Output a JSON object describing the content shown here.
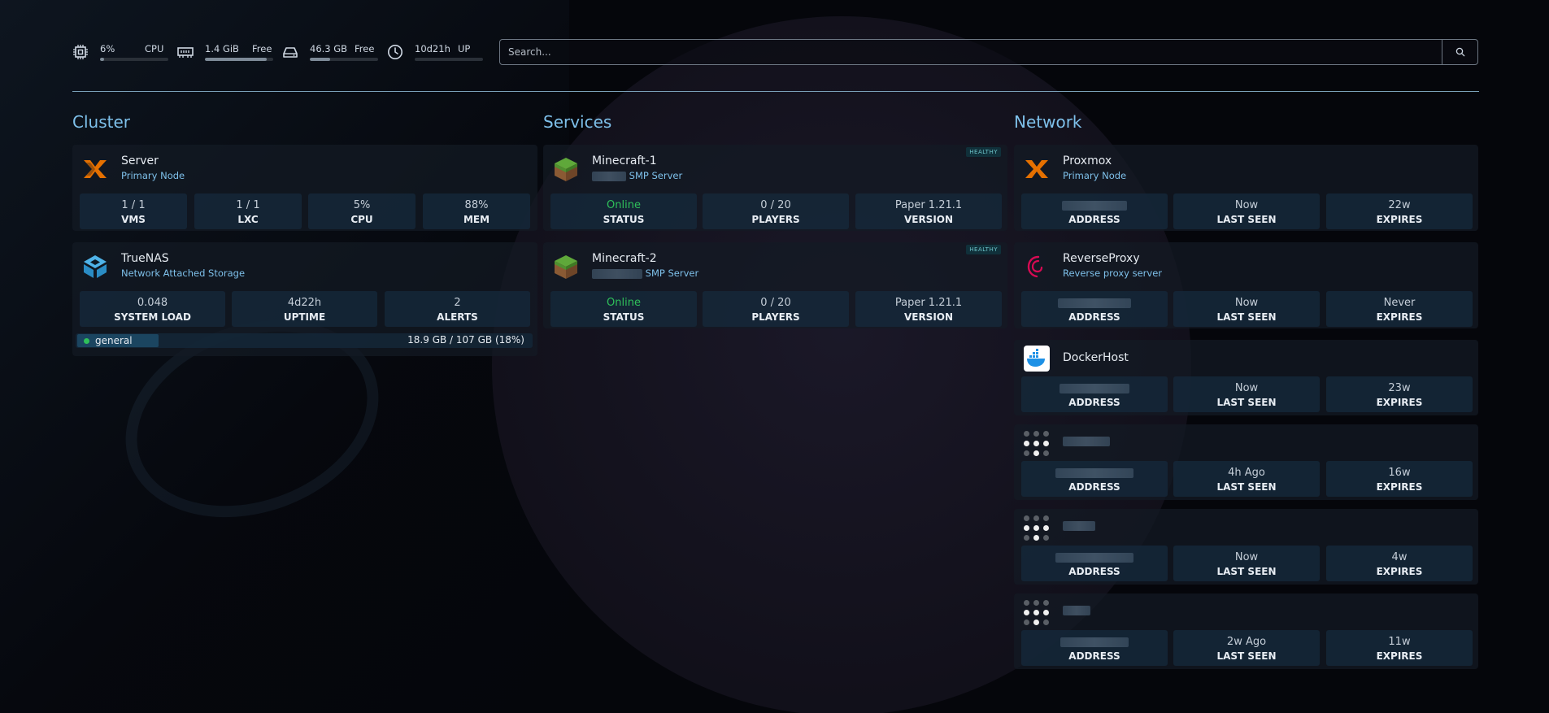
{
  "topbar": {
    "cpu": {
      "value": "6%",
      "label": "CPU",
      "fraction": 0.06
    },
    "memory": {
      "value": "1.4 GiB",
      "label": "Free",
      "fraction": 0.9
    },
    "disk": {
      "value": "46.3 GB",
      "label": "Free",
      "fraction": 0.3
    },
    "uptime": {
      "value": "10d21h",
      "label": "UP",
      "fraction": 0.0
    },
    "search_placeholder": "Search..."
  },
  "cluster": {
    "title": "Cluster",
    "cards": [
      {
        "name": "Server",
        "subtitle": "Primary Node",
        "logo": "proxmox-logo",
        "stats": [
          {
            "value": "1 / 1",
            "label": "VMS"
          },
          {
            "value": "1 / 1",
            "label": "LXC"
          },
          {
            "value": "5%",
            "label": "CPU"
          },
          {
            "value": "88%",
            "label": "MEM"
          }
        ]
      },
      {
        "name": "TrueNAS",
        "subtitle": "Network Attached Storage",
        "logo": "truenas-logo",
        "stats": [
          {
            "value": "0.048",
            "label": "SYSTEM LOAD"
          },
          {
            "value": "4d22h",
            "label": "UPTIME"
          },
          {
            "value": "2",
            "label": "ALERTS"
          }
        ],
        "pool": {
          "name": "general",
          "usage": "18.9 GB / 107 GB  (18%)"
        }
      }
    ]
  },
  "services": {
    "title": "Services",
    "cards": [
      {
        "name": "Minecraft-1",
        "subtitle": "SMP Server",
        "badge": "HEALTHY",
        "logo": "minecraft-grass-icon",
        "stats": [
          {
            "value": "Online",
            "label": "STATUS"
          },
          {
            "value": "0 / 20",
            "label": "PLAYERS"
          },
          {
            "value": "Paper 1.21.1",
            "label": "VERSION"
          }
        ]
      },
      {
        "name": "Minecraft-2",
        "subtitle": "SMP Server",
        "badge": "HEALTHY",
        "logo": "minecraft-grass-icon",
        "stats": [
          {
            "value": "Online",
            "label": "STATUS"
          },
          {
            "value": "0 / 20",
            "label": "PLAYERS"
          },
          {
            "value": "Paper 1.21.1",
            "label": "VERSION"
          }
        ]
      }
    ]
  },
  "network": {
    "title": "Network",
    "cards": [
      {
        "name": "Proxmox",
        "subtitle": "Primary Node",
        "logo": "proxmox-logo",
        "stats": [
          {
            "value": "",
            "label": "ADDRESS"
          },
          {
            "value": "Now",
            "label": "LAST SEEN"
          },
          {
            "value": "22w",
            "label": "EXPIRES"
          }
        ]
      },
      {
        "name": "ReverseProxy",
        "subtitle": "Reverse proxy server",
        "logo": "debian-logo",
        "stats": [
          {
            "value": "",
            "label": "ADDRESS"
          },
          {
            "value": "Now",
            "label": "LAST SEEN"
          },
          {
            "value": "Never",
            "label": "EXPIRES"
          }
        ]
      },
      {
        "name": "DockerHost",
        "subtitle": "",
        "logo": "docker-logo",
        "stats": [
          {
            "value": "",
            "label": "ADDRESS"
          },
          {
            "value": "Now",
            "label": "LAST SEEN"
          },
          {
            "value": "23w",
            "label": "EXPIRES"
          }
        ]
      },
      {
        "name": "",
        "subtitle": "",
        "logo": "device-dots-icon",
        "stats": [
          {
            "value": "",
            "label": "ADDRESS"
          },
          {
            "value": "4h Ago",
            "label": "LAST SEEN"
          },
          {
            "value": "16w",
            "label": "EXPIRES"
          }
        ]
      },
      {
        "name": "",
        "subtitle": "",
        "logo": "device-dots-icon",
        "stats": [
          {
            "value": "",
            "label": "ADDRESS"
          },
          {
            "value": "Now",
            "label": "LAST SEEN"
          },
          {
            "value": "4w",
            "label": "EXPIRES"
          }
        ]
      },
      {
        "name": "",
        "subtitle": "",
        "logo": "device-dots-icon",
        "stats": [
          {
            "value": "",
            "label": "ADDRESS"
          },
          {
            "value": "2w Ago",
            "label": "LAST SEEN"
          },
          {
            "value": "11w",
            "label": "EXPIRES"
          }
        ]
      }
    ]
  },
  "colors": {
    "accent": "#7ec0ea",
    "online": "#2fc05a",
    "badge": "#6cc2c8"
  }
}
